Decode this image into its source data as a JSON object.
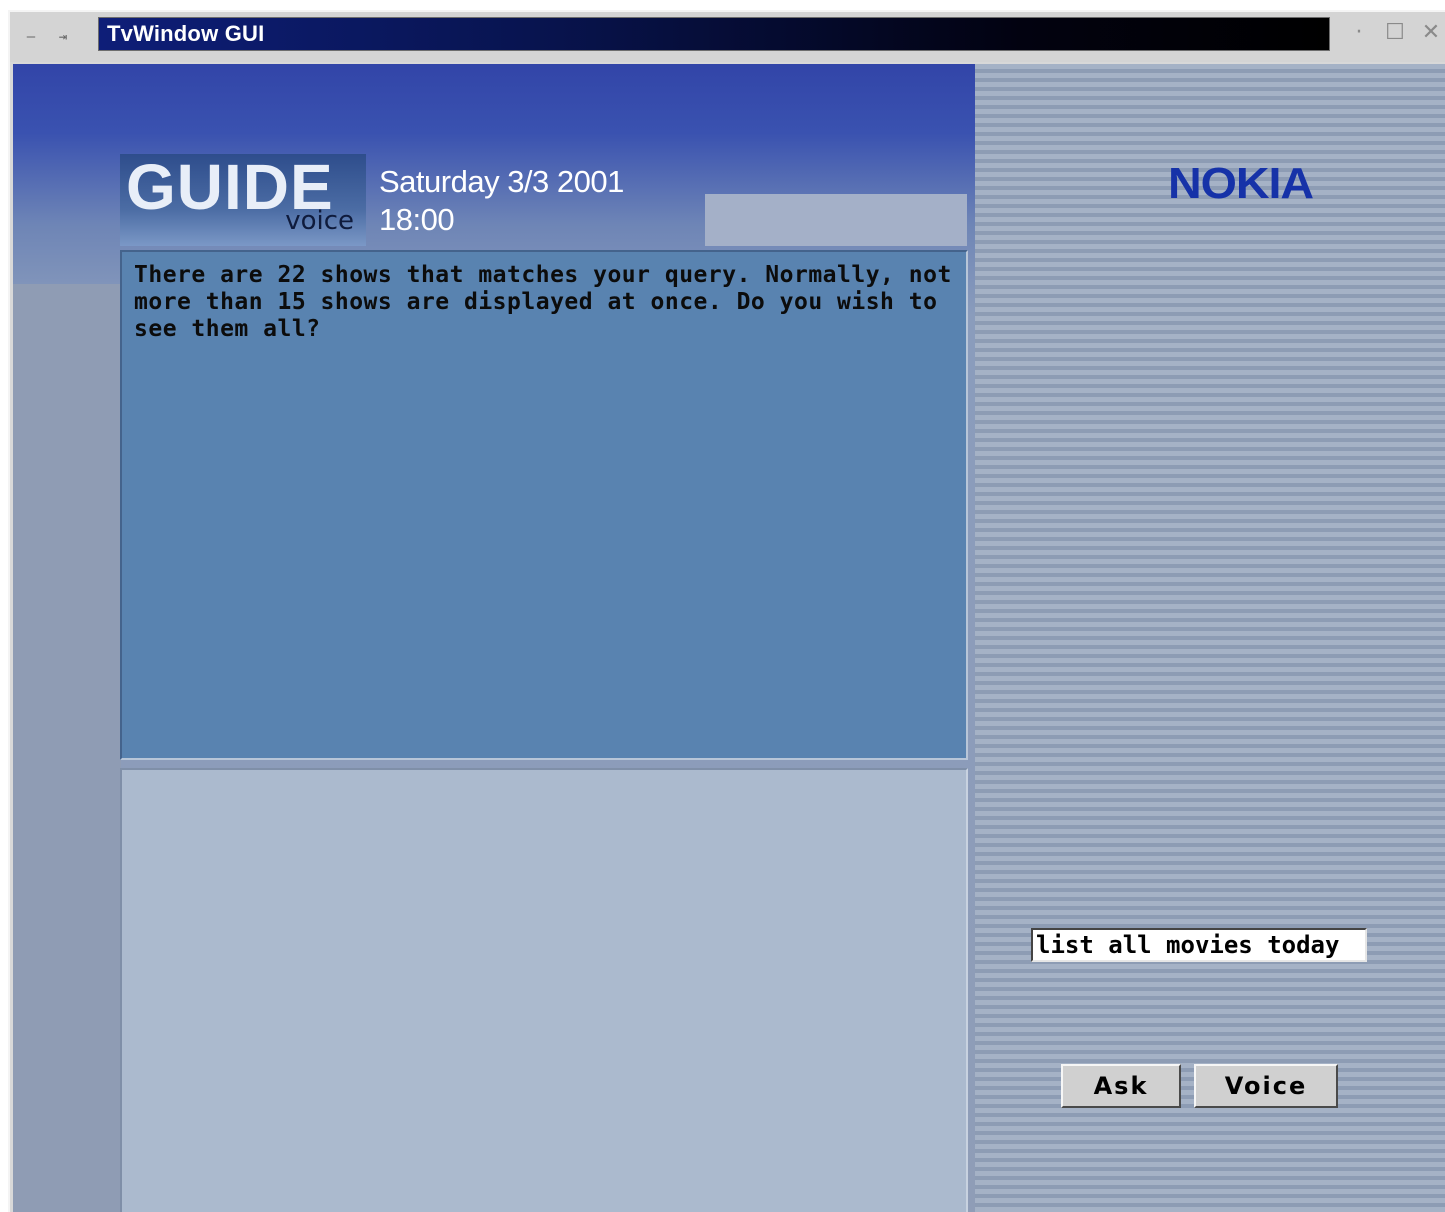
{
  "window": {
    "title": "TvWindow GUI",
    "left_controls": {
      "minimize_glyph": "—",
      "pin_glyph": "⇥"
    },
    "right_controls": {
      "dot_glyph": "·",
      "maximize_glyph": "☐",
      "close_glyph": "✕"
    }
  },
  "header": {
    "logo_main": "GUIDE",
    "logo_sub": "voice",
    "date": "Saturday 3/3 2001",
    "time": "18:00"
  },
  "message": {
    "text": "There are 22 shows that matches your query. Normally, not more than 15 shows are displayed at once. Do you wish to see them all?"
  },
  "brand": {
    "name": "NOKIA"
  },
  "query": {
    "value": "list all movies today"
  },
  "buttons": {
    "ask_label": "Ask",
    "voice_label": "Voice"
  },
  "colors": {
    "brand": "#1632a8",
    "panel_blue": "#5983b0",
    "panel_light": "#abbace"
  }
}
